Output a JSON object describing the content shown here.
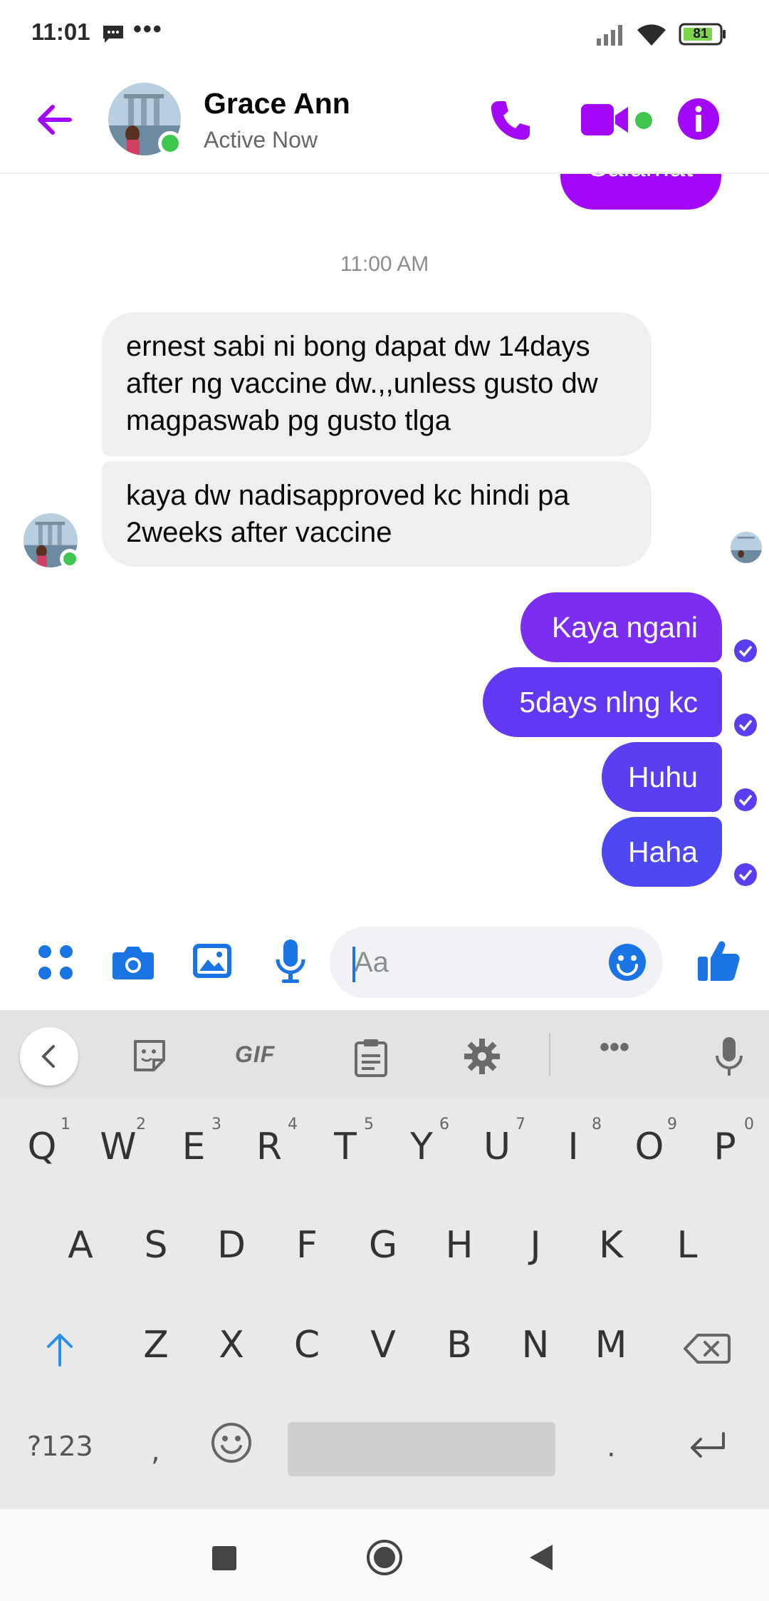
{
  "status_bar": {
    "time": "11:01",
    "dots": "•••",
    "battery": "81",
    "icons": [
      "message-icon",
      "signal-icon",
      "wifi-icon",
      "battery-icon"
    ]
  },
  "header": {
    "contact_name": "Grace Ann",
    "contact_status": "Active Now",
    "accent_color": "#a307f7",
    "online_color": "#3dc74f"
  },
  "chat": {
    "previous_bubble_text": "Salamat",
    "timestamp": "11:00 AM",
    "incoming": [
      "ernest sabi ni bong dapat dw 14days after ng vaccine dw.,,unless gusto dw magpaswab pg gusto tlga",
      "kaya dw nadisapproved kc hindi pa 2weeks after vaccine"
    ],
    "outgoing": [
      "Kaya ngani",
      "5days nlng kc",
      "Huhu",
      "Haha"
    ]
  },
  "composer": {
    "placeholder": "Aa"
  },
  "keyboard": {
    "toolbar_gif": "GIF",
    "toolbar_more": "•••",
    "row1": [
      "Q",
      "W",
      "E",
      "R",
      "T",
      "Y",
      "U",
      "I",
      "O",
      "P"
    ],
    "row1_hints": [
      "1",
      "2",
      "3",
      "4",
      "5",
      "6",
      "7",
      "8",
      "9",
      "0"
    ],
    "row2": [
      "A",
      "S",
      "D",
      "F",
      "G",
      "H",
      "J",
      "K",
      "L"
    ],
    "row3": [
      "Z",
      "X",
      "C",
      "V",
      "B",
      "N",
      "M"
    ],
    "symbols_key": "?123",
    "comma_key": ",",
    "period_key": "."
  }
}
